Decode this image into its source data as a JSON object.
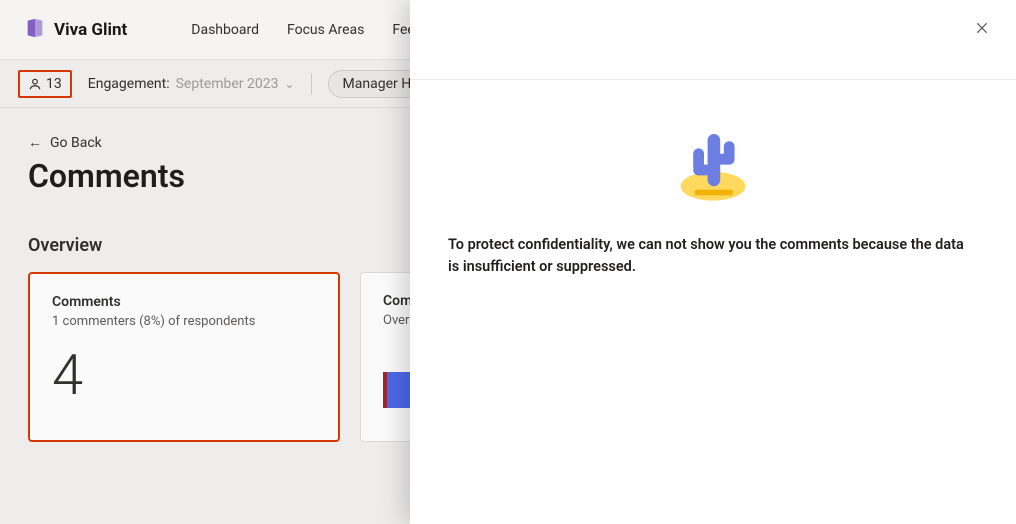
{
  "header": {
    "brand": "Viva Glint",
    "nav": [
      "Dashboard",
      "Focus Areas",
      "Feed"
    ]
  },
  "filterbar": {
    "respondent_count": "13",
    "engagement_label": "Engagement:",
    "engagement_period": "September 2023",
    "hierarchy_label": "Manager Hierarchy:"
  },
  "page": {
    "back_label": "Go Back",
    "title": "Comments",
    "overview_label": "Overview"
  },
  "cards": {
    "comments": {
      "title": "Comments",
      "subline": "1 commenters (8%) of respondents",
      "value": "4"
    },
    "sentiment": {
      "title": "Comm",
      "subline": "Overal"
    }
  },
  "overlay": {
    "message": "To protect confidentiality, we can not show you the comments because the data is insufficient or suppressed."
  }
}
